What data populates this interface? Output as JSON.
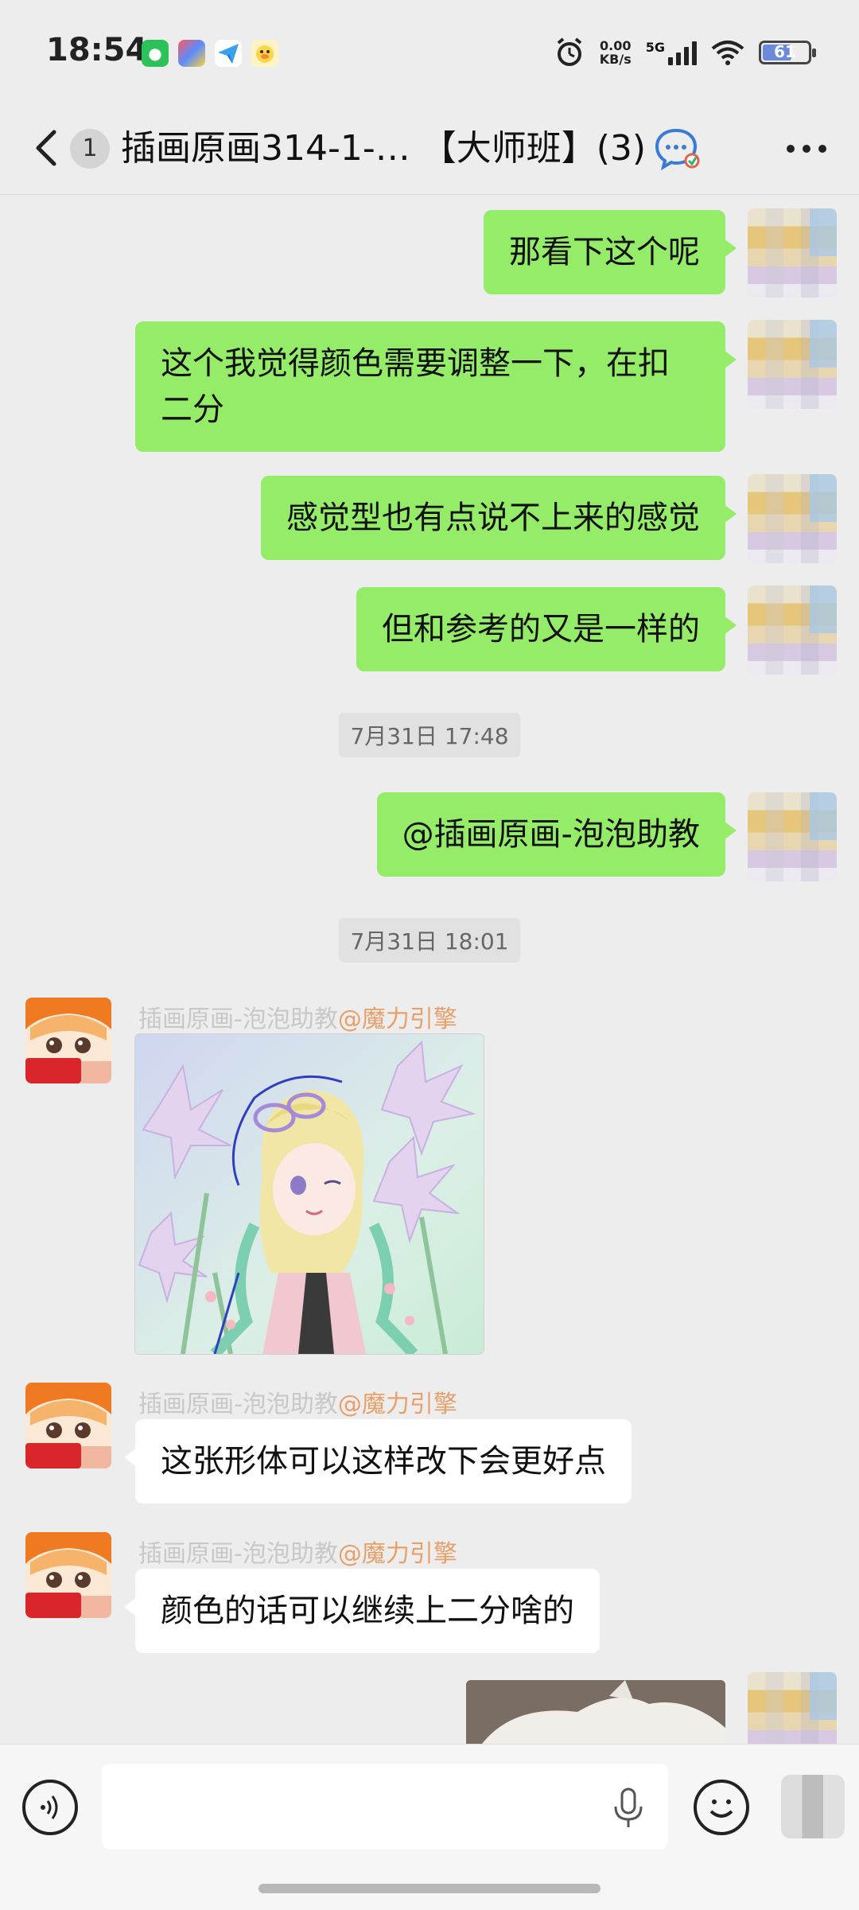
{
  "status_bar": {
    "time": "18:54",
    "net_speed_value": "0.00",
    "net_speed_unit": "KB/s",
    "network": "5G",
    "battery": "61",
    "apps": [
      "wechat-icon",
      "multi-color-app-icon",
      "paper-plane-icon",
      "duck-icon"
    ]
  },
  "nav": {
    "unread_count": "1",
    "title": "插画原画314-1-… 【大师班】(3)"
  },
  "messages_sent": [
    "那看下这个呢",
    "这个我觉得颜色需要调整一下，在扣二分",
    "感觉型也有点说不上来的感觉",
    "但和参考的又是一样的",
    "@插画原画-泡泡助教"
  ],
  "timestamps": [
    "7月31日 17:48",
    "7月31日 18:01"
  ],
  "received": {
    "sender_name": "插画原画-泡泡助教",
    "sender_tag": "@魔力引擎",
    "messages": [
      "这张形体可以这样改下会更好点",
      "颜色的话可以继续上二分啥的"
    ]
  },
  "input": {
    "placeholder": ""
  },
  "colors": {
    "sent_bubble": "#95ec69",
    "received_bubble": "#ffffff",
    "background": "#ededed",
    "sender_tag": "#e8a06a"
  }
}
